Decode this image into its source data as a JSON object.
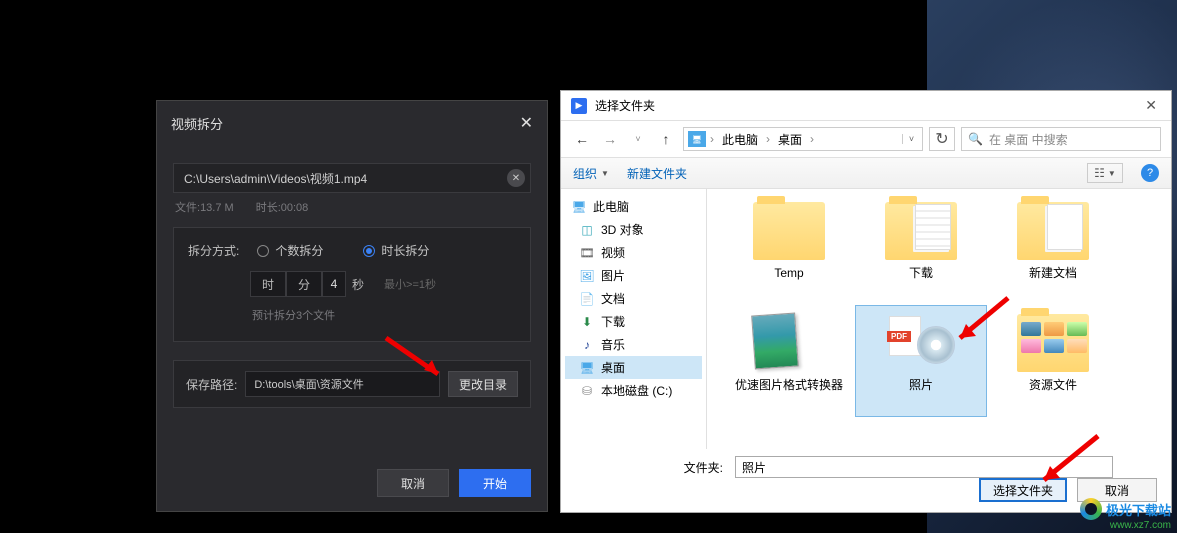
{
  "split": {
    "title": "视频拆分",
    "path": "C:\\Users\\admin\\Videos\\视频1.mp4",
    "file_label": "文件:",
    "file_size": "13.7 M",
    "duration_label": "时长:",
    "duration": "00:08",
    "method_label": "拆分方式:",
    "opt_count": "个数拆分",
    "opt_time": "时长拆分",
    "time_hour": "时",
    "time_min": "分",
    "seconds_value": "4",
    "time_sec": "秒",
    "min_hint": "最小>=1秒",
    "estimate": "预计拆分3个文件",
    "save_label": "保存路径:",
    "save_path": "D:\\tools\\桌面\\资源文件",
    "change_btn": "更改目录",
    "cancel": "取消",
    "start": "开始"
  },
  "folder": {
    "title": "选择文件夹",
    "crumb1": "此电脑",
    "crumb2": "桌面",
    "search_placeholder": "在 桌面 中搜索",
    "organize": "组织",
    "new_folder": "新建文件夹",
    "tree": {
      "pc": "此电脑",
      "obj3d": "3D 对象",
      "video": "视频",
      "pic": "图片",
      "doc": "文档",
      "dl": "下载",
      "music": "音乐",
      "desk": "桌面",
      "disk_c": "本地磁盘 (C:)"
    },
    "items": {
      "temp": "Temp",
      "dl": "下载",
      "newdoc": "新建文档",
      "conv": "优速图片格式转换器",
      "photo": "照片",
      "res": "资源文件"
    },
    "folder_label": "文件夹:",
    "folder_value": "照片",
    "select_btn": "选择文件夹",
    "cancel_btn": "取消"
  },
  "wm": {
    "name": "极光下载站",
    "url": "www.xz7.com"
  }
}
